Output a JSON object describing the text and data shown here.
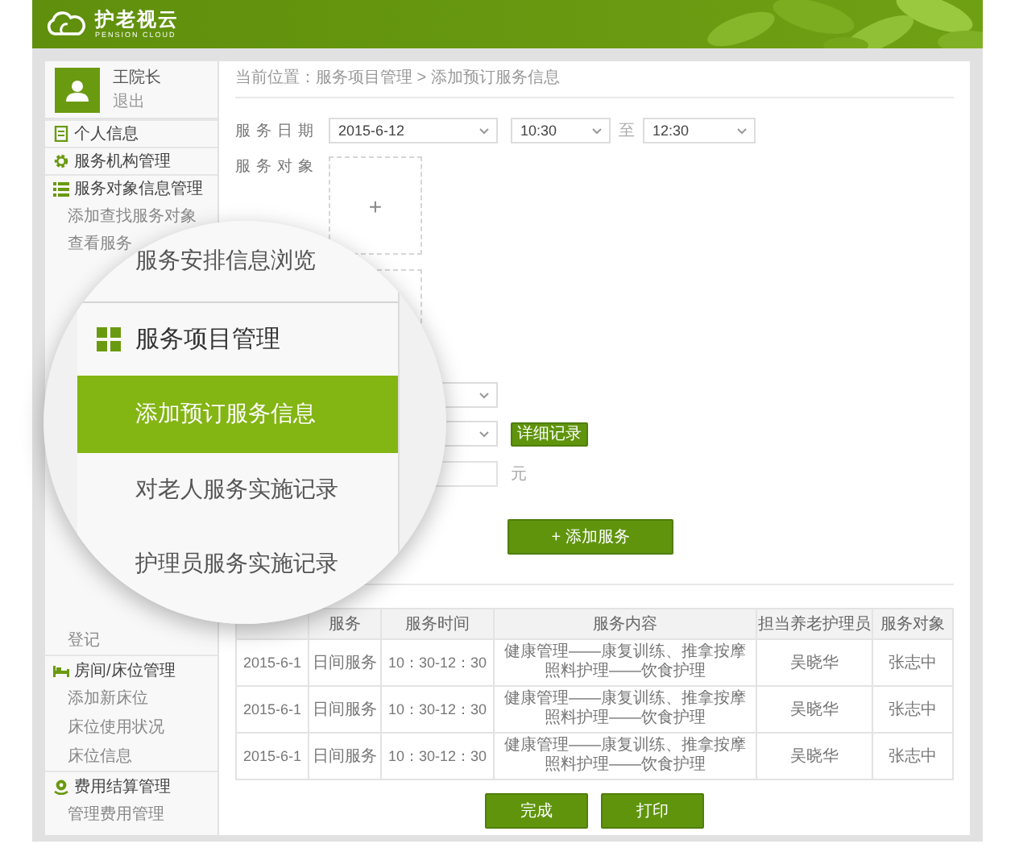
{
  "header": {
    "logo_title": "护老视云",
    "logo_subtitle": "PENSION CLOUD"
  },
  "user": {
    "name": "王院长",
    "logout": "退出"
  },
  "sidebar": {
    "top_items": [
      {
        "label": "个人信息",
        "kind": "group"
      },
      {
        "label": "服务机构管理",
        "kind": "group"
      },
      {
        "label": "服务对象信息管理",
        "kind": "group"
      },
      {
        "label": "添加查找服务对象",
        "kind": "link"
      },
      {
        "label": "查看服务",
        "kind": "link"
      }
    ],
    "bottom_items": [
      {
        "label": "登记",
        "kind": "link"
      },
      {
        "label": "房间/床位管理",
        "kind": "group"
      },
      {
        "label": "添加新床位",
        "kind": "link"
      },
      {
        "label": "床位使用状况",
        "kind": "link"
      },
      {
        "label": "床位信息",
        "kind": "link"
      },
      {
        "label": "费用结算管理",
        "kind": "group"
      },
      {
        "label": "管理费用管理",
        "kind": "link"
      }
    ]
  },
  "breadcrumb": "当前位置：服务项目管理 > 添加预订服务信息",
  "form": {
    "date_label": "服务日期",
    "date": "2015-6-12",
    "start_time": "10:30",
    "range_separator": "至",
    "end_time": "12:30",
    "target_label": "服务对象",
    "upload_plus": "+",
    "detail_button": "详细记录",
    "unit": "元",
    "add_button": "+ 添加服务"
  },
  "table": {
    "columns": [
      "服务",
      "服务时间",
      "服务内容",
      "担当养老护理员",
      "服务对象"
    ],
    "rows": [
      {
        "date": "2015-6-1",
        "type": "日间服务",
        "time": "10：30-12：30",
        "content_lines": [
          "健康管理——康复训练、推拿按摩",
          "照料护理——饮食护理"
        ],
        "caregiver": "吴晓华",
        "target": "张志中"
      },
      {
        "date": "2015-6-1",
        "type": "日间服务",
        "time": "10：30-12：30",
        "content_lines": [
          "健康管理——康复训练、推拿按摩",
          "照料护理——饮食护理"
        ],
        "caregiver": "吴晓华",
        "target": "张志中"
      },
      {
        "date": "2015-6-1",
        "type": "日间服务",
        "time": "10：30-12：30",
        "content_lines": [
          "健康管理——康复训练、推拿按摩",
          "照料护理——饮食护理"
        ],
        "caregiver": "吴晓华",
        "target": "张志中"
      }
    ]
  },
  "buttons": [
    "完成",
    "打印"
  ],
  "magnifier": {
    "items": [
      {
        "label": "服务安排信息浏览",
        "kind": "link",
        "selected": false
      },
      {
        "label": "服务项目管理",
        "kind": "group"
      },
      {
        "label": "添加预订服务信息",
        "kind": "link",
        "selected": true
      },
      {
        "label": "对老人服务实施记录",
        "kind": "link",
        "selected": false
      },
      {
        "label": "护理员服务实施记录",
        "kind": "link",
        "selected": false
      }
    ]
  }
}
